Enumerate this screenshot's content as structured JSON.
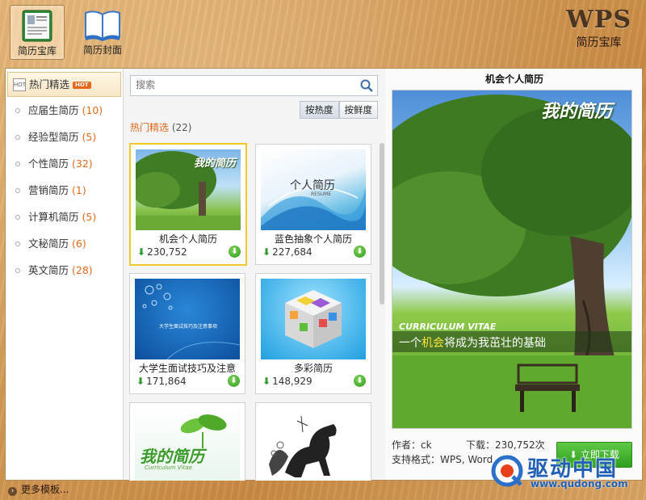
{
  "toolbar": {
    "library_label": "简历宝库",
    "cover_label": "简历封面"
  },
  "logo": {
    "brand": "WPS",
    "subtitle": "简历宝库"
  },
  "sidebar": {
    "items": [
      {
        "label": "热门精选",
        "count": "",
        "badge": "HOT",
        "icon_text": "HOT"
      },
      {
        "label": "应届生简历",
        "count": "(10)"
      },
      {
        "label": "经验型简历",
        "count": "(5)"
      },
      {
        "label": "个性简历",
        "count": "(32)"
      },
      {
        "label": "营销简历",
        "count": "(1)"
      },
      {
        "label": "计算机简历",
        "count": "(5)"
      },
      {
        "label": "文秘简历",
        "count": "(6)"
      },
      {
        "label": "英文简历",
        "count": "(28)"
      }
    ]
  },
  "search": {
    "placeholder": "搜索"
  },
  "sort": {
    "by_popularity": "按热度",
    "by_freshness": "按鲜度"
  },
  "section": {
    "title": "热门精选",
    "count": "(22)"
  },
  "templates": [
    {
      "name": "机会个人简历",
      "downloads": "230,752",
      "thumb_text": "我的简历"
    },
    {
      "name": "蓝色抽象个人简历",
      "downloads": "227,684",
      "thumb_text": "个人简历",
      "thumb_sub": "RESUME"
    },
    {
      "name": "大学生面试技巧及注意",
      "downloads": "171,864",
      "thumb_text": "大学生面试技巧及注意事项"
    },
    {
      "name": "多彩简历",
      "downloads": "148,929"
    },
    {
      "name": "",
      "downloads": "",
      "thumb_text": "我的简历",
      "thumb_sub": "Curriculum Vitae"
    },
    {
      "name": "",
      "downloads": ""
    }
  ],
  "preview": {
    "title": "机会个人简历",
    "image_heading": "我的简历",
    "cv_label": "CURRICULUM VITAE",
    "slogan_pre": "一个",
    "slogan_hl": "机会",
    "slogan_post": "将成为我茁壮的基础",
    "author": "作者：ck",
    "downloads": "下载：230,752次",
    "formats": "支持格式：WPS, Word",
    "download_button": "立即下载"
  },
  "footer": {
    "more_templates": "更多模板..."
  },
  "watermark": {
    "name": "驱动中国",
    "url": "www.qudong.com"
  },
  "colors": {
    "accent_orange": "#e0691b",
    "download_green": "#2f9a2f",
    "selected_border": "#f0c828"
  }
}
